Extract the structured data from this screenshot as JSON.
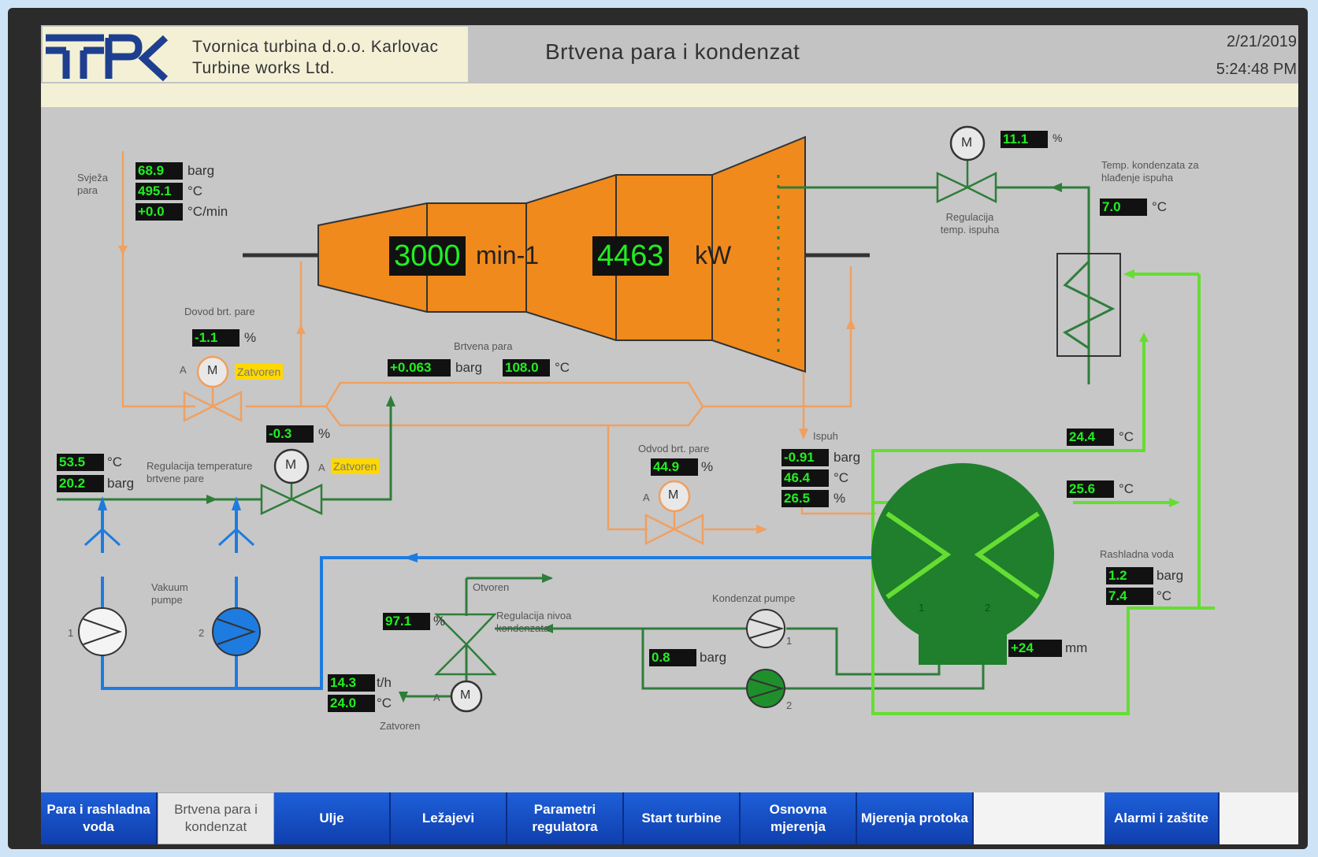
{
  "header": {
    "company_line1": "Tvornica turbina d.o.o. Karlovac",
    "company_line2": "Turbine works Ltd.",
    "title": "Brtvena para i kondenzat",
    "date": "2/21/2019",
    "time": "5:24:48 PM"
  },
  "turbine": {
    "speed": "3000",
    "speed_unit": "min-1",
    "power": "4463",
    "power_unit": "kW"
  },
  "fresh_steam": {
    "label": "Svježa para",
    "pressure": "68.9",
    "pressure_unit": "barg",
    "temp": "495.1",
    "temp_unit": "°C",
    "rate": "+0.0",
    "rate_unit": "°C/min"
  },
  "seal_supply": {
    "label": "Dovod brt. pare",
    "value": "-1.1",
    "unit": "%",
    "mode": "A",
    "status": "Zatvoren"
  },
  "seal_temp_reg": {
    "label": "Regulacija temperature brtvene pare",
    "value": "-0.3",
    "unit": "%",
    "mode": "A",
    "status": "Zatvoren",
    "temp": "53.5",
    "temp_unit": "°C",
    "pressure": "20.2",
    "pressure_unit": "barg"
  },
  "seal_steam": {
    "label": "Brtvena para",
    "pressure": "+0.063",
    "pressure_unit": "barg",
    "temp": "108.0",
    "temp_unit": "°C"
  },
  "seal_discharge": {
    "label": "Odvod brt. pare",
    "value": "44.9",
    "unit": "%",
    "mode": "A"
  },
  "exhaust": {
    "label": "Ispuh",
    "pressure": "-0.91",
    "pressure_unit": "barg",
    "temp": "46.4",
    "temp_unit": "°C",
    "pct": "26.5",
    "pct_unit": "%"
  },
  "exhaust_temp_reg": {
    "label": "Regulacija temp. ispuha",
    "value": "11.1",
    "unit": "%",
    "motor": "M"
  },
  "cond_temp_cooling": {
    "label": "Temp. kondenzata za hlađenje ispuha",
    "value": "7.0",
    "unit": "°C"
  },
  "cooling_water": {
    "label": "Rashladna voda",
    "t_out1": "24.4",
    "t_out2": "25.6",
    "pressure": "1.2",
    "pressure_unit": "barg",
    "temp": "7.4",
    "temp_unit": "°C",
    "unit_c": "°C"
  },
  "condenser": {
    "level": "+24",
    "level_unit": "mm",
    "side1": "1",
    "side2": "2"
  },
  "vacuum_pumps": {
    "label": "Vakuum pumpe",
    "p1": "1",
    "p2": "2"
  },
  "level_reg": {
    "label": "Regulacija nivoa kondenzata",
    "value": "97.1",
    "unit": "%",
    "top_status": "Otvoren",
    "bottom_status": "Zatvoren",
    "mode": "A",
    "flow": "14.3",
    "flow_unit": "t/h",
    "temp": "24.0",
    "temp_unit": "°C"
  },
  "cond_pumps": {
    "label": "Kondenzat pumpe",
    "pressure": "0.8",
    "pressure_unit": "barg",
    "p1": "1",
    "p2": "2"
  },
  "motor_label": "M",
  "nav": [
    {
      "label": "Para i rashladna voda"
    },
    {
      "label": "Brtvena para i kondenzat"
    },
    {
      "label": "Ulje"
    },
    {
      "label": "Ležajevi"
    },
    {
      "label": "Parametri regulatora"
    },
    {
      "label": "Start turbine"
    },
    {
      "label": "Osnovna mjerenja"
    },
    {
      "label": "Mjerenja protoka"
    },
    {
      "label": "Alarmi i zaštite"
    }
  ],
  "colors": {
    "turbine": "#f08a1c",
    "steam_line": "#f0a060",
    "water_line": "#2f7d3a",
    "cooling_line": "#66dd33",
    "vacuum_line": "#1e7be0",
    "condenser": "#1f7f2c"
  }
}
